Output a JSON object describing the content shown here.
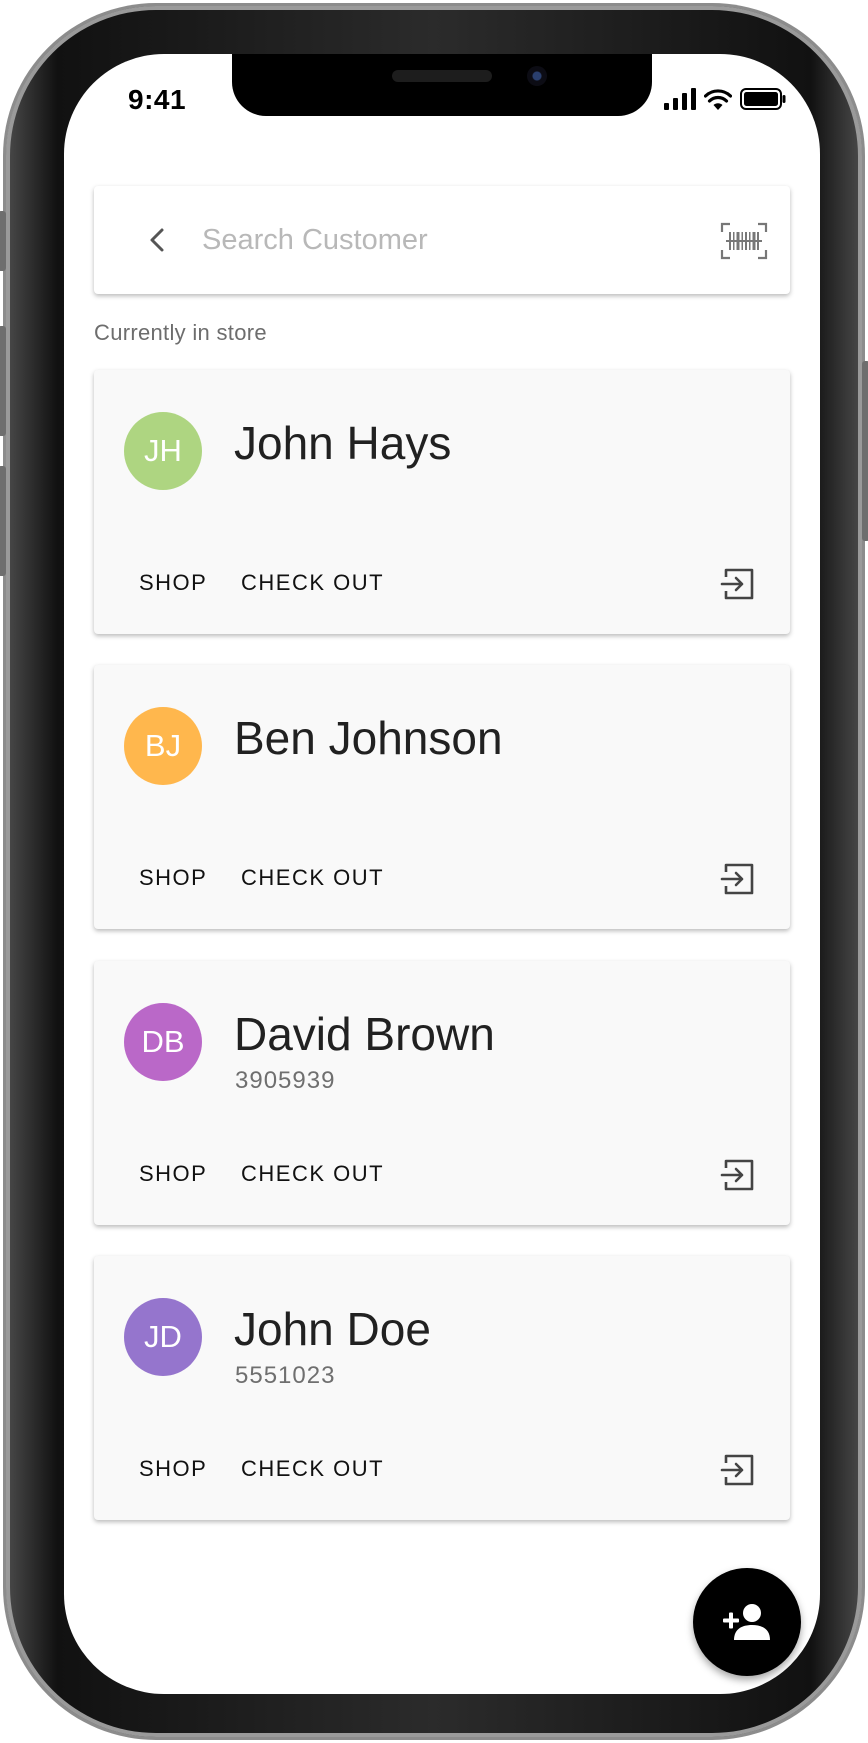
{
  "status_bar": {
    "time": "9:41"
  },
  "search": {
    "placeholder": "Search Customer"
  },
  "section": {
    "title": "Currently in store"
  },
  "customers": [
    {
      "initials": "JH",
      "name": "John Hays",
      "id": "",
      "avatar_color": "#aed581"
    },
    {
      "initials": "BJ",
      "name": "Ben Johnson",
      "id": "",
      "avatar_color": "#ffb74d"
    },
    {
      "initials": "DB",
      "name": "David Brown",
      "id": "3905939",
      "avatar_color": "#ba68c8"
    },
    {
      "initials": "JD",
      "name": "John Doe",
      "id": "5551023",
      "avatar_color": "#9575cd"
    }
  ],
  "actions": {
    "shop_label": "SHOP",
    "checkout_label": "CHECK OUT"
  },
  "icons": {
    "back": "chevron-left-icon",
    "barcode": "barcode-scan-icon",
    "exit": "exit-to-app-icon",
    "fab": "person-add-icon"
  },
  "colors": {
    "fab": "#000000",
    "card_bg": "#f9f9f9",
    "label": "#6d6d6d"
  }
}
